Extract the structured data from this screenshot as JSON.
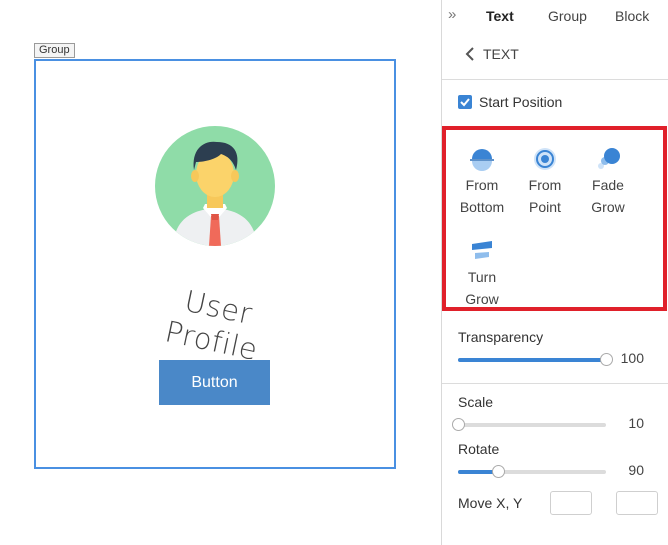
{
  "canvas": {
    "group_tag": "Group",
    "profile_title": "User Profile",
    "button_label": "Button"
  },
  "panel": {
    "tabs": [
      {
        "label": "Text",
        "active": true
      },
      {
        "label": "Group",
        "active": false
      },
      {
        "label": "Block",
        "active": false
      }
    ],
    "back_label": "TEXT",
    "start_position": {
      "label": "Start Position",
      "checked": true
    },
    "animations": [
      {
        "line1": "From",
        "line2": "Bottom",
        "icon": "from-bottom-icon"
      },
      {
        "line1": "From",
        "line2": "Point",
        "icon": "from-point-icon"
      },
      {
        "line1": "Fade",
        "line2": "Grow",
        "icon": "fade-grow-icon"
      },
      {
        "line1": "Turn",
        "line2": "Grow",
        "icon": "turn-grow-icon"
      }
    ],
    "transparency": {
      "label": "Transparency",
      "value": "100",
      "fraction": 1.0
    },
    "scale": {
      "label": "Scale",
      "value": "10",
      "fraction": 0.0
    },
    "rotate": {
      "label": "Rotate",
      "value": "90",
      "fraction": 0.27
    },
    "move": {
      "label": "Move X, Y",
      "x": "",
      "y": ""
    }
  },
  "colors": {
    "accent": "#3a84d4",
    "highlight": "#e0202a",
    "canvas_button": "#4a88c8",
    "group_border": "#4a90e2"
  }
}
